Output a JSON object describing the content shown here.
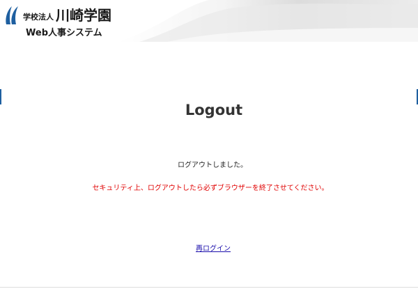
{
  "header": {
    "org_small": "学校法人",
    "org_name": "川崎学園",
    "system_name": "Web人事システム",
    "logo_icon": "school-logo-mark",
    "brand_color": "#1e5fa0"
  },
  "main": {
    "title": "Logout",
    "message": "ログアウトしました。",
    "warning": "セキュリティ上、ログアウトしたら必ずブラウザーを終了させてください。",
    "warning_color": "#e00000",
    "relogin_link": "再ログイン"
  }
}
